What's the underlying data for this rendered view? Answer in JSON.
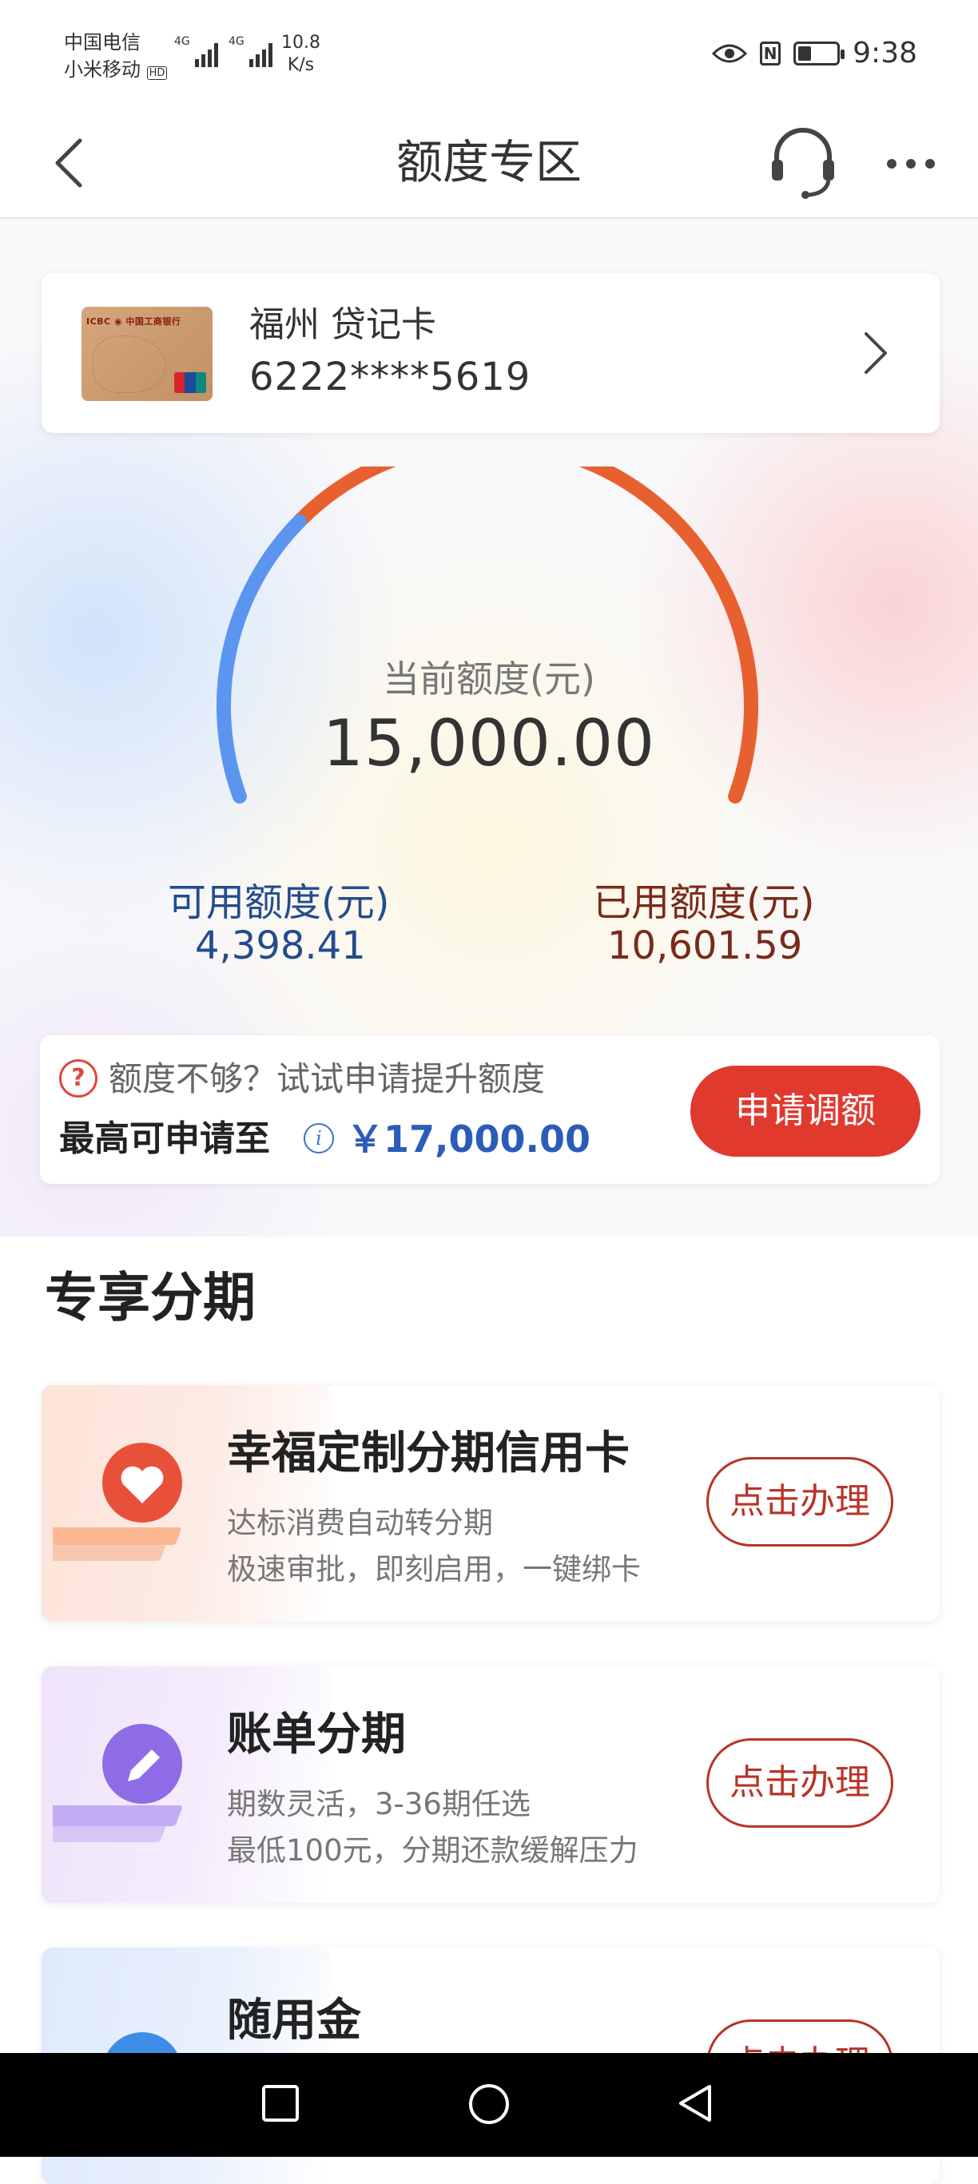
{
  "status_bar": {
    "carrier1": "中国电信",
    "carrier2": "小米移动",
    "hd": "HD",
    "net1": "4G",
    "net2": "4G",
    "speed_value": "10.8",
    "speed_unit": "K/s",
    "time": "9:38",
    "battery_level": 0.35
  },
  "header": {
    "title": "额度专区"
  },
  "card": {
    "name": "福州 贷记卡",
    "number": "6222****5619",
    "logo_text": "ICBC 中国工商银行"
  },
  "limit": {
    "current_label": "当前额度(元)",
    "current_value": "15,000.00",
    "available_label": "可用额度(元)",
    "available_value": "4,398.41",
    "used_label": "已用额度(元)",
    "used_value": "10,601.59",
    "available_fraction": 0.2932,
    "colors": {
      "available": "#5b95ef",
      "used": "#e8602f"
    }
  },
  "raise": {
    "hint": "额度不够？试试申请提升额度",
    "max_label": "最高可申请至",
    "max_amount": "￥17,000.00",
    "button": "申请调额"
  },
  "section": {
    "title": "专享分期"
  },
  "offers": [
    {
      "name": "幸福定制分期信用卡",
      "desc1": "达标消费自动转分期",
      "desc2": "极速审批，即刻启用，一键绑卡",
      "button": "点击办理",
      "icon": "heart-icon",
      "color": "#e8503a"
    },
    {
      "name": "账单分期",
      "desc1": "期数灵活，3-36期任选",
      "desc2": "最低100元，分期还款缓解压力",
      "button": "点击办理",
      "icon": "pencil-icon",
      "color": "#8e6ce6"
    },
    {
      "name": "随用金",
      "desc1": "",
      "desc2": "",
      "button": "点击办理",
      "icon": "rocket-icon",
      "color": "#3d8de8"
    }
  ]
}
